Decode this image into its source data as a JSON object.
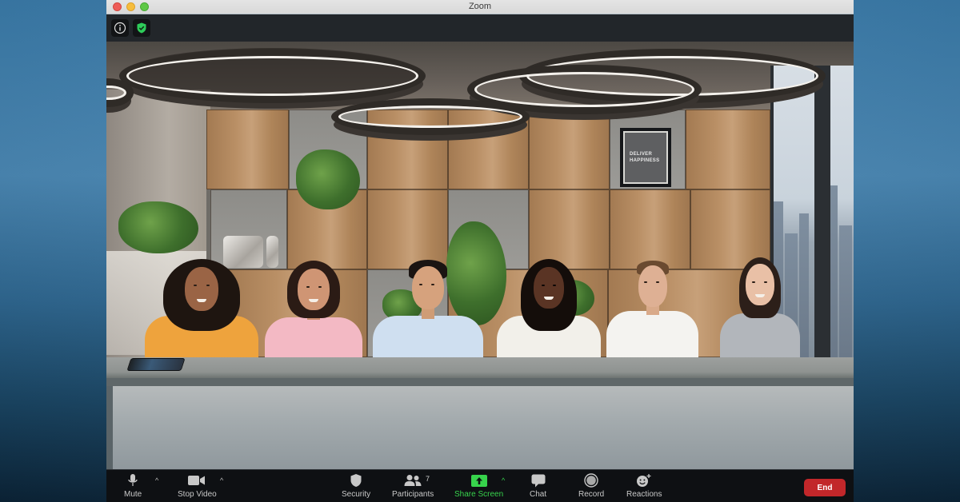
{
  "window": {
    "title": "Zoom"
  },
  "meeting_header": {
    "info_icon": "info-icon",
    "encryption_icon": "shield-check-icon"
  },
  "scene": {
    "poster_lines": [
      "DELIVER",
      "HAPPINESS"
    ],
    "participants_visible": 6
  },
  "toolbar": {
    "items": [
      {
        "label": "Mute",
        "icon": "microphone-icon",
        "has_caret": true
      },
      {
        "label": "Stop Video",
        "icon": "video-camera-icon",
        "has_caret": true
      },
      {
        "label": "Security",
        "icon": "shield-icon",
        "has_caret": false
      },
      {
        "label": "Participants",
        "icon": "participants-icon",
        "badge": "7",
        "has_caret": false
      },
      {
        "label": "Share Screen",
        "icon": "share-screen-icon",
        "has_caret": true
      },
      {
        "label": "Chat",
        "icon": "chat-bubble-icon",
        "has_caret": false
      },
      {
        "label": "Record",
        "icon": "record-icon",
        "has_caret": false
      },
      {
        "label": "Reactions",
        "icon": "reaction-smiley-icon",
        "has_caret": false
      }
    ],
    "caret_glyph": "^",
    "end_label": "End"
  },
  "colors": {
    "share_screen_green": "#37d34c",
    "end_red": "#c2272a",
    "toolbar_bg": "#0e1013",
    "secure_shield_green": "#2ecc5a"
  }
}
